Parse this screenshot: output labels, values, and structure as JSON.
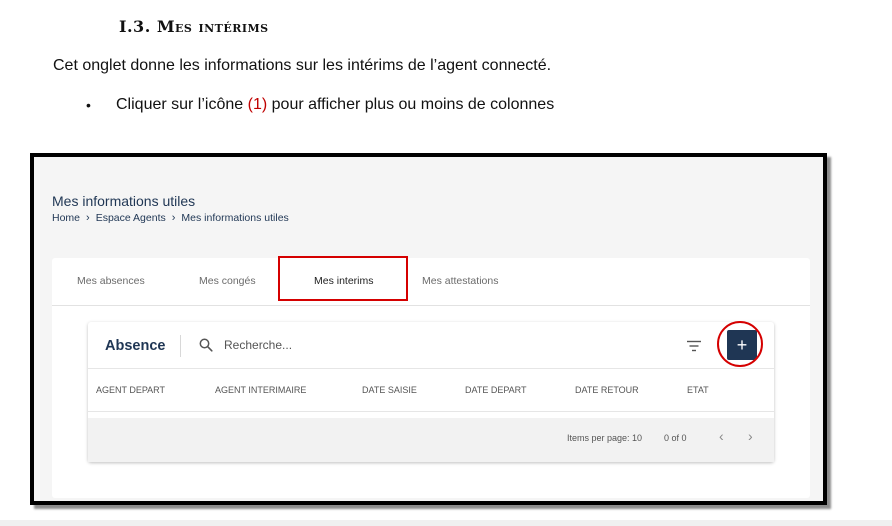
{
  "document": {
    "heading": "I.3. Mes intérims",
    "paragraph": "Cet onglet donne les informations sur les intérims de l’agent connecté.",
    "bullet": {
      "symbol": "•",
      "before": "Cliquer sur l’icône",
      "marker": "(1)",
      "after": "pour  afficher plus ou moins de colonnes"
    }
  },
  "app": {
    "page_title": "Mes informations utiles",
    "breadcrumb": [
      "Home",
      "Espace Agents",
      "Mes informations utiles"
    ],
    "breadcrumb_separator": "›",
    "tabs": [
      {
        "label": "Mes absences"
      },
      {
        "label": "Mes congés"
      },
      {
        "label": "Mes interims"
      },
      {
        "label": "Mes attestations"
      }
    ],
    "active_tab": "Mes interims",
    "table": {
      "title": "Absence",
      "search_placeholder": "Recherche...",
      "add_label": "+",
      "columns": [
        "AGENT DEPART",
        "AGENT INTERIMAIRE",
        "DATE SAISIE",
        "DATE DEPART",
        "DATE RETOUR",
        "ETAT"
      ],
      "rows": [],
      "paginator": {
        "items_per_page_label": "Items per page: 10",
        "range": "0 of 0",
        "prev": "‹",
        "next": "›"
      }
    }
  },
  "colors": {
    "accent": "#1f3654",
    "highlight": "#d50000",
    "marker_text": "#c00000"
  }
}
